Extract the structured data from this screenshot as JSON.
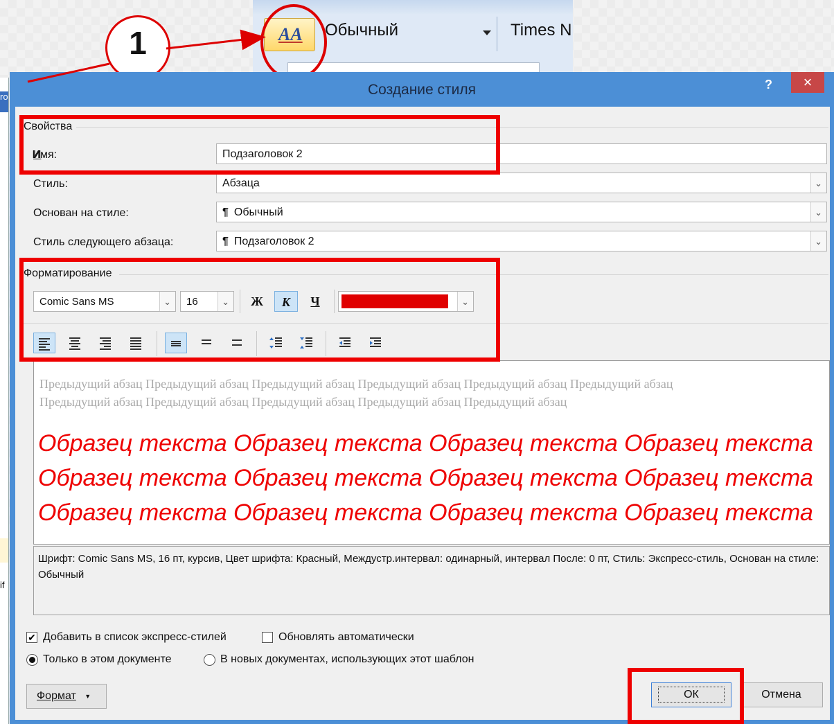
{
  "ribbon": {
    "style_value": "Обычный",
    "font_value": "Times N"
  },
  "callout_number": "1",
  "left_edge": {
    "tab_text": "ro",
    "side_text": "if"
  },
  "dialog": {
    "title": "Создание стиля",
    "help_label": "?",
    "close_label": "×",
    "properties": {
      "section_label": "Свойства",
      "name_label": "Имя:",
      "name_value": "Подзаголовок 2",
      "style_type_label": "Стиль:",
      "style_type_value": "Абзаца",
      "based_on_label": "Основан на стиле:",
      "based_on_value": "Обычный",
      "next_style_label": "Стиль следующего абзаца:",
      "next_style_value": "Подзаголовок 2",
      "pilcrow": "¶"
    },
    "formatting": {
      "section_label": "Форматирование",
      "font_value": "Comic Sans MS",
      "size_value": "16",
      "bold_label": "Ж",
      "italic_label": "К",
      "underline_label": "Ч",
      "font_color": "#e00000",
      "italic_active": true,
      "align_left_active": true,
      "single_spacing_active": true
    },
    "preview": {
      "previous_paragraph": "Предыдущий абзац Предыдущий абзац Предыдущий абзац Предыдущий абзац Предыдущий абзац Предыдущий абзац Предыдущий абзац Предыдущий абзац Предыдущий абзац Предыдущий абзац Предыдущий абзац",
      "sample_lines": [
        "Образец текста Образец текста Образец текста Образец текста",
        "Образец текста Образец текста Образец текста Образец текста",
        "Образец текста Образец текста Образец текста Образец текста"
      ]
    },
    "description": "Шрифт: Comic Sans MS, 16 пт, курсив, Цвет шрифта: Красный, Междустр.интервал:  одинарный, интервал После:  0 пт, Стиль: Экспресс-стиль, Основан на стиле: Обычный",
    "options": {
      "add_to_quick_styles": {
        "label": "Добавить в список экспресс-стилей",
        "checked": true
      },
      "auto_update": {
        "label": "Обновлять автоматически",
        "checked": false
      },
      "only_this_document": {
        "label": "Только в этом документе",
        "selected": true
      },
      "new_documents": {
        "label": "В новых документах, использующих этот шаблон",
        "selected": false
      }
    },
    "buttons": {
      "format": "Формат",
      "format_arrow": "▼",
      "ok": "ОК",
      "cancel": "Отмена"
    }
  },
  "colors": {
    "highlight": "#e00000",
    "titlebar": "#4c8fd6",
    "sample_text": "#e00000"
  }
}
